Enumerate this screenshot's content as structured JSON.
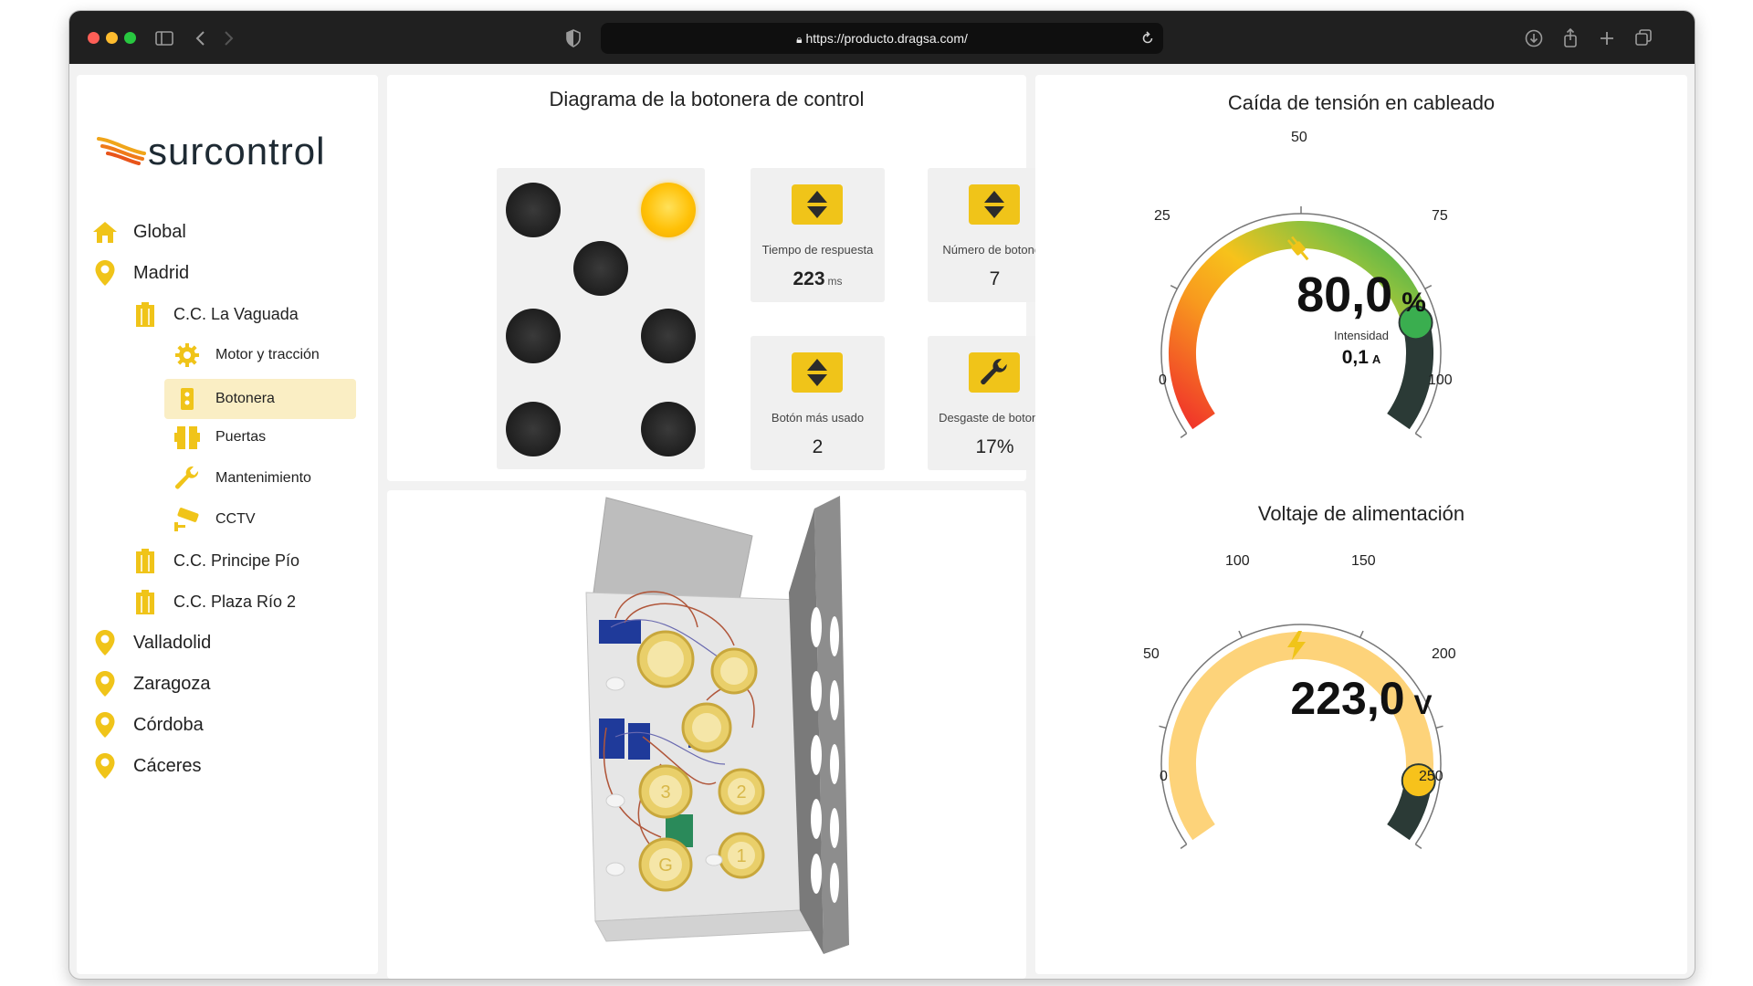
{
  "browser": {
    "url": "https://producto.dragsa.com/"
  },
  "brand": {
    "logo_text": "surcontrol",
    "accent": "#f0c419",
    "primary_text": "#1e2a33"
  },
  "sidebar": {
    "items": [
      {
        "label": "Global",
        "icon": "home-icon",
        "level": 0
      },
      {
        "label": "Madrid",
        "icon": "location-pin-icon",
        "level": 0
      },
      {
        "label": "C.C. La Vaguada",
        "icon": "building-icon",
        "level": 1
      },
      {
        "label": "Motor y tracción",
        "icon": "gear-icon",
        "level": 2
      },
      {
        "label": "Botonera",
        "icon": "button-panel-icon",
        "level": 2,
        "active": true
      },
      {
        "label": "Puertas",
        "icon": "doors-icon",
        "level": 2
      },
      {
        "label": "Mantenimiento",
        "icon": "wrench-icon",
        "level": 2
      },
      {
        "label": "CCTV",
        "icon": "cctv-camera-icon",
        "level": 2
      },
      {
        "label": "C.C. Principe Pío",
        "icon": "building-icon",
        "level": 1
      },
      {
        "label": "C.C. Plaza Río 2",
        "icon": "building-icon",
        "level": 1
      },
      {
        "label": "Valladolid",
        "icon": "location-pin-icon",
        "level": 0
      },
      {
        "label": "Zaragoza",
        "icon": "location-pin-icon",
        "level": 0
      },
      {
        "label": "Córdoba",
        "icon": "location-pin-icon",
        "level": 0
      },
      {
        "label": "Cáceres",
        "icon": "location-pin-icon",
        "level": 0
      }
    ]
  },
  "diagram": {
    "title": "Diagrama de la botonera de control",
    "buttons_total": 7,
    "lit_button_index": 1,
    "cards": [
      {
        "label": "Tiempo de respuesta",
        "value": "223",
        "unit": "ms",
        "icon": "up-down-arrows-icon"
      },
      {
        "label": "Número de botones",
        "value": "7",
        "unit": "",
        "icon": "up-down-arrows-icon"
      },
      {
        "label": "Botón más usado",
        "value": "2",
        "unit": "",
        "icon": "up-down-arrows-icon"
      },
      {
        "label": "Desgaste de botones",
        "value": "17%",
        "unit": "",
        "icon": "wrench-icon"
      }
    ]
  },
  "model": {
    "floor_labels": [
      "3",
      "2",
      "1",
      "G"
    ]
  },
  "gauges": [
    {
      "title": "Caída de tensión en cableado",
      "value": "80,0",
      "unit": "%",
      "value_num": 80,
      "min": 0,
      "max": 100,
      "ticks": [
        "0",
        "25",
        "50",
        "75",
        "100"
      ],
      "sub_label": "Intensidad",
      "sub_value": "0,1",
      "sub_unit": "A",
      "icon": "plug-icon"
    },
    {
      "title": "Voltaje de alimentación",
      "value": "223,0",
      "unit": "V",
      "value_num": 223,
      "min": 0,
      "max": 250,
      "ticks": [
        "0",
        "50",
        "100",
        "150",
        "200",
        "250"
      ],
      "icon": "lightning-icon"
    }
  ]
}
